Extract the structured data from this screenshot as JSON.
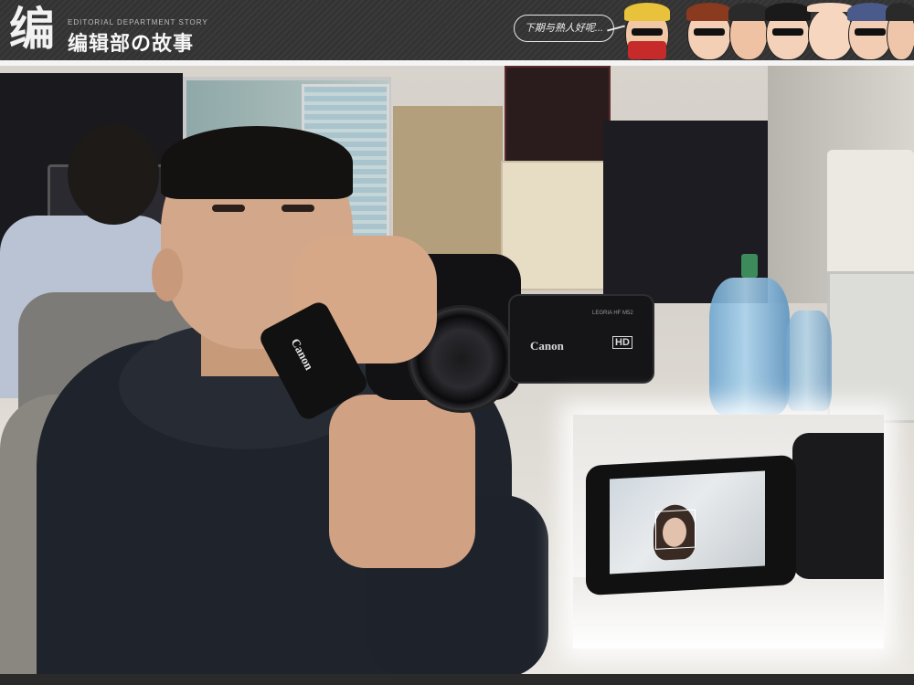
{
  "header": {
    "logo_char": "编",
    "subtitle": "EDITORIAL DEPARTMENT STORY",
    "title_part1": "编辑部",
    "title_accent": "の",
    "title_part2": "故事",
    "bubble_text": "下期与熟人好呢..."
  },
  "photo": {
    "camera_brand": "Canon",
    "camera_hd": "HD",
    "camera_model": "LEGRIA HF M52",
    "strap_brand": "Canon"
  },
  "colors": {
    "header_bg": "#333333",
    "border": "#f4f4f4"
  }
}
